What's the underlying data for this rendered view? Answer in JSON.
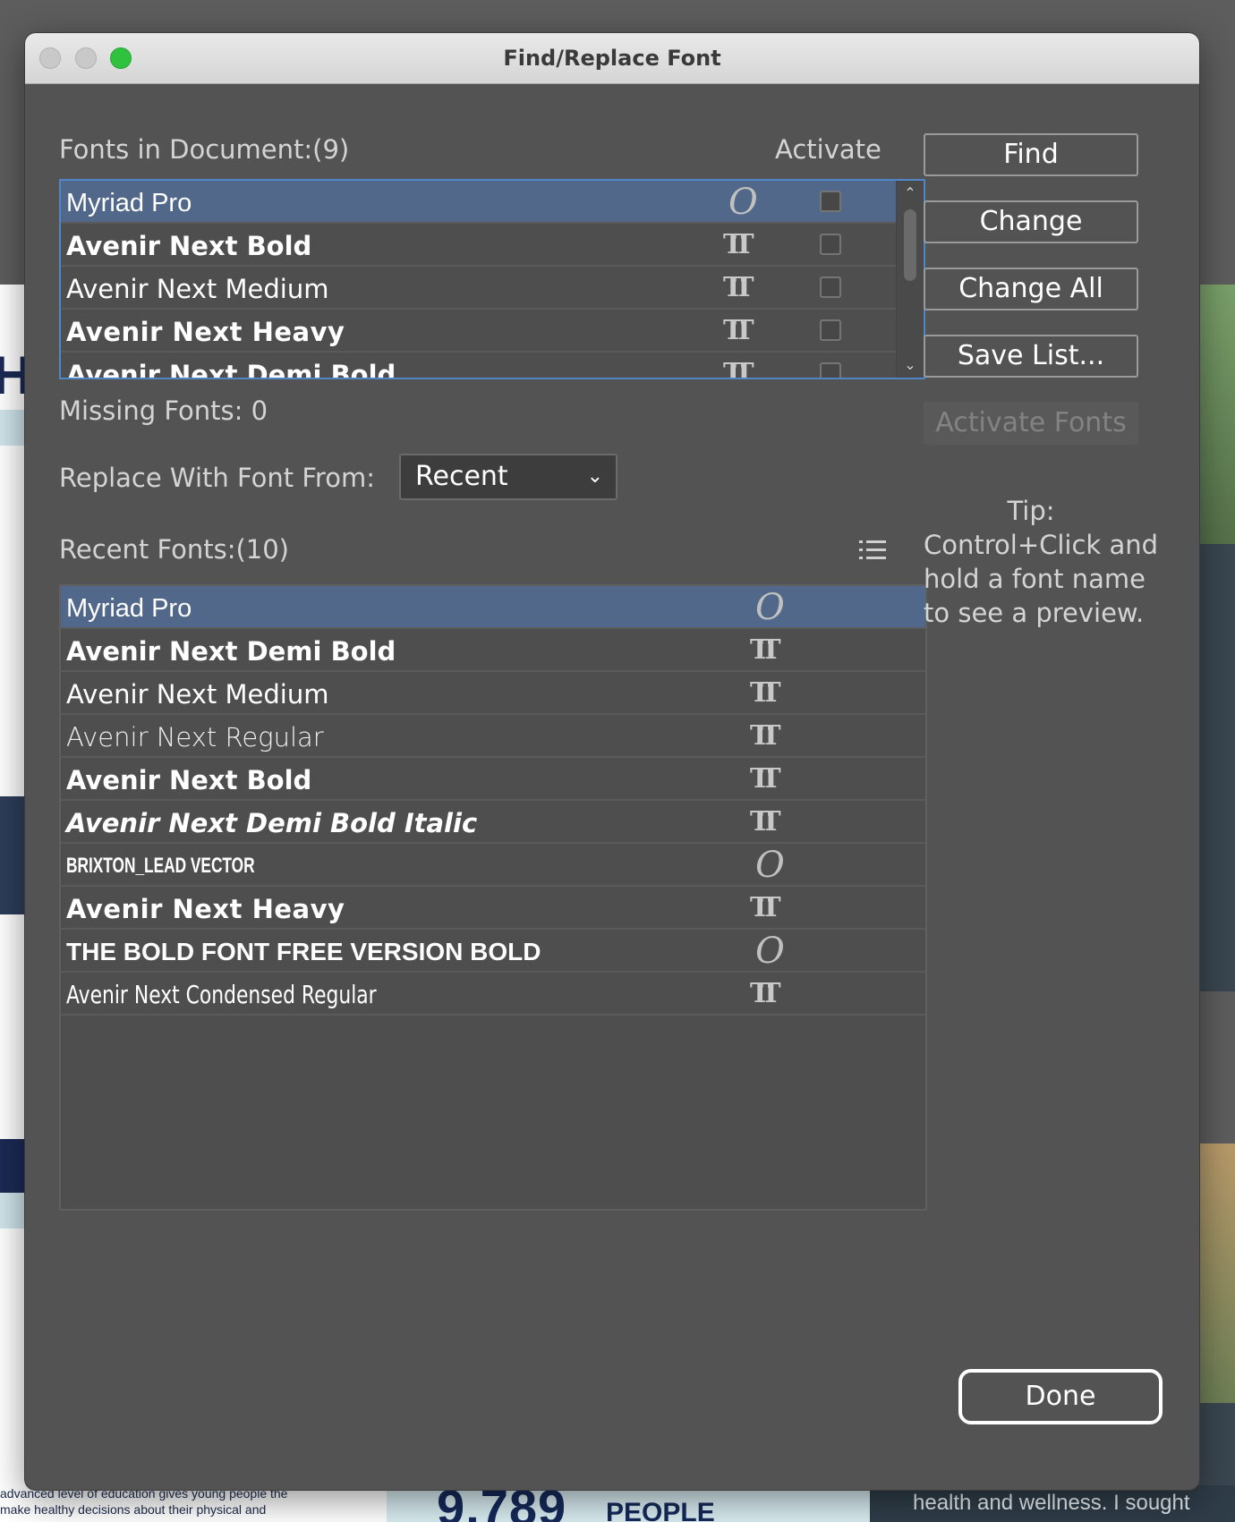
{
  "window": {
    "title": "Find/Replace Font"
  },
  "fonts_in_document": {
    "label": "Fonts in Document:(9)",
    "activate_header": "Activate",
    "items": [
      {
        "name": "Myriad Pro",
        "type_icon": "opentype-icon",
        "selected": true,
        "activate_checked": false
      },
      {
        "name": "Avenir Next Bold",
        "type_icon": "truetype-icon",
        "selected": false,
        "activate_checked": false
      },
      {
        "name": "Avenir Next Medium",
        "type_icon": "truetype-icon",
        "selected": false,
        "activate_checked": false
      },
      {
        "name": "Avenir Next Heavy",
        "type_icon": "truetype-icon",
        "selected": false,
        "activate_checked": false
      },
      {
        "name": "Avenir Next Demi Bold",
        "type_icon": "truetype-icon",
        "selected": false,
        "activate_checked": false
      }
    ]
  },
  "missing_fonts": "Missing Fonts: 0",
  "replace_with": {
    "label": "Replace With Font From:",
    "value": "Recent"
  },
  "recent_fonts": {
    "label": "Recent Fonts:(10)",
    "items": [
      {
        "name": "Myriad Pro",
        "type_icon": "opentype-icon",
        "selected": true
      },
      {
        "name": "Avenir Next Demi Bold",
        "type_icon": "truetype-icon",
        "selected": false
      },
      {
        "name": "Avenir Next Medium",
        "type_icon": "truetype-icon",
        "selected": false
      },
      {
        "name": "Avenir Next Regular",
        "type_icon": "truetype-icon",
        "selected": false
      },
      {
        "name": "Avenir Next Bold",
        "type_icon": "truetype-icon",
        "selected": false
      },
      {
        "name": "Avenir Next Demi Bold Italic",
        "type_icon": "truetype-icon",
        "selected": false
      },
      {
        "name": "BRIXTON_LEAD VECTOR",
        "type_icon": "opentype-icon",
        "selected": false
      },
      {
        "name": "Avenir Next Heavy",
        "type_icon": "truetype-icon",
        "selected": false
      },
      {
        "name": "THE BOLD FONT FREE VERSION BOLD",
        "type_icon": "opentype-icon",
        "selected": false
      },
      {
        "name": "Avenir Next Condensed Regular",
        "type_icon": "truetype-icon",
        "selected": false
      }
    ]
  },
  "buttons": {
    "find": "Find",
    "change": "Change",
    "change_all": "Change All",
    "save_list": "Save List...",
    "activate_fonts": "Activate Fonts",
    "done": "Done"
  },
  "tip": {
    "title": "Tip:",
    "body": "Control+Click and hold a font name to see a preview."
  },
  "icons": {
    "opentype_glyph": "O",
    "truetype_glyph": "TT",
    "chevron": "⌄",
    "scroll_up": "⌃",
    "scroll_down": "⌄"
  },
  "background_document": {
    "stat_number": "9,789",
    "stat_label": "PEOPLE",
    "bottom_left_line_1": "advanced level of education gives young people the",
    "bottom_left_line_2": "make healthy decisions about their physical and",
    "bottom_right_text": "health and wellness. I sought"
  },
  "colors": {
    "dialog_bg": "#535353",
    "selection": "#51688a",
    "focus_border": "#4e86c8",
    "zoom_button": "#2fc23f"
  }
}
